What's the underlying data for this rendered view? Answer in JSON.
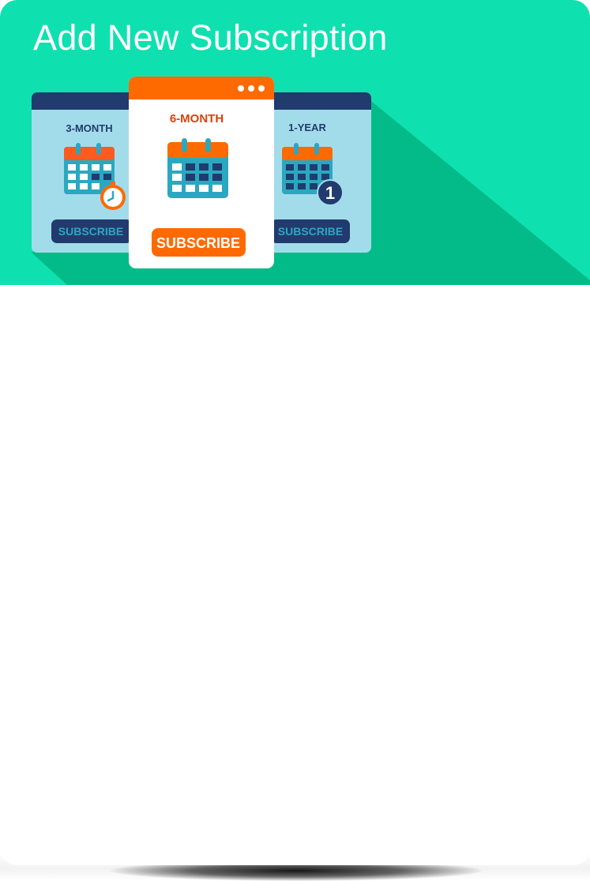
{
  "header": {
    "title": "Add New Subscription"
  },
  "plans": [
    {
      "name": "3-MONTH",
      "button_label": "SUBSCRIBE",
      "icon": "calendar-clock-icon"
    },
    {
      "name": "6-MONTH",
      "button_label": "SUBSCRIBE",
      "icon": "calendar-icon"
    },
    {
      "name": "1-YEAR",
      "button_label": "SUBSCRIBE",
      "icon": "calendar-one-icon",
      "badge": "1"
    }
  ],
  "colors": {
    "header_bg": "#0fe0b0",
    "long_shadow": "#03bb89",
    "card_side_bg": "#a2dcea",
    "card_side_header": "#213b6e",
    "accent_orange": "#ff6a00",
    "navy": "#213b6e",
    "teal": "#2ba8c0"
  }
}
